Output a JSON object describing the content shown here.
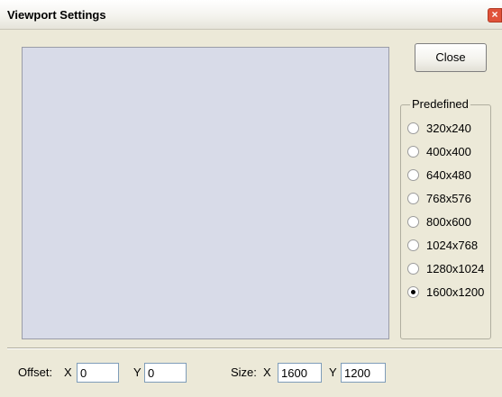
{
  "window": {
    "title": "Viewport Settings",
    "close_glyph": "×"
  },
  "close_button": {
    "label": "Close"
  },
  "predefined": {
    "legend": "Predefined",
    "options": [
      {
        "label": "320x240",
        "checked": false
      },
      {
        "label": "400x400",
        "checked": false
      },
      {
        "label": "640x480",
        "checked": false
      },
      {
        "label": "768x576",
        "checked": false
      },
      {
        "label": "800x600",
        "checked": false
      },
      {
        "label": "1024x768",
        "checked": false
      },
      {
        "label": "1280x1024",
        "checked": false
      },
      {
        "label": "1600x1200",
        "checked": true
      }
    ]
  },
  "offset": {
    "label": "Offset:",
    "x_label": "X",
    "x_value": "0",
    "y_label": "Y",
    "y_value": "0"
  },
  "size": {
    "label": "Size:",
    "x_label": "X",
    "x_value": "1600",
    "y_label": "Y",
    "y_value": "1200"
  },
  "colors": {
    "viewport_bg": "#d8dbe8",
    "dialog_bg": "#ece9d8",
    "close_x": "#e0523a"
  }
}
